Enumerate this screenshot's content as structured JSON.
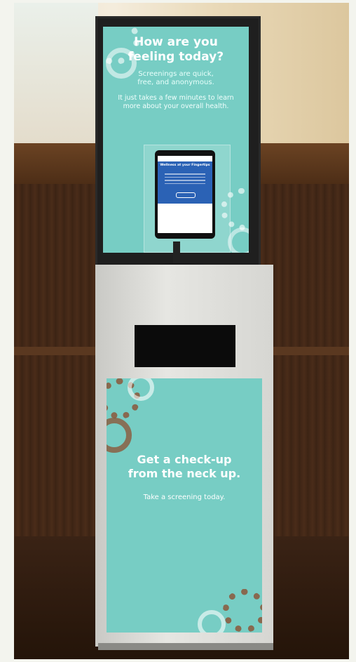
{
  "image": {
    "scene": "health screening kiosk",
    "colors": {
      "panel": "#77cdc4",
      "cabinet": "#d6d6d2",
      "wood": "#4a2c19",
      "tablet_screen": "#2b62b5"
    }
  },
  "top_sign": {
    "headline_line1": "How are you",
    "headline_line2": "feeling today?",
    "subline_1": "Screenings are quick,",
    "subline_2": "free, and anonymous.",
    "body_1": "It just takes a few minutes to learn",
    "body_2": "more about your overall health."
  },
  "tablet": {
    "screen_title": "Wellness at your Fingertips"
  },
  "cabinet_sign": {
    "headline_line1": "Get a check-up",
    "headline_line2": "from the neck up.",
    "tagline": "Take a screening today."
  }
}
